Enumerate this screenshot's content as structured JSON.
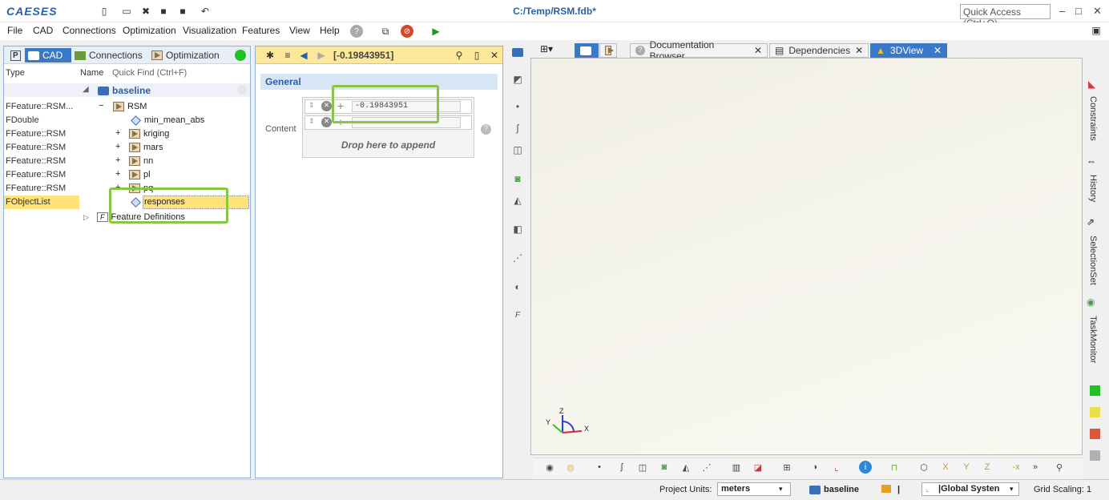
{
  "app": {
    "logo": "CAESES",
    "title": "C:/Temp/RSM.fdb*",
    "quick_access": "Quick Access (Ctrl+Q)"
  },
  "menu": [
    "File",
    "CAD",
    "Connections",
    "Optimization",
    "Visualization",
    "Features",
    "View",
    "Help"
  ],
  "left_panel": {
    "tabs": [
      "P",
      "CAD",
      "Connections",
      "Optimization"
    ],
    "columns": {
      "type": "Type",
      "name": "Name",
      "quick_find": "Quick Find (Ctrl+F)"
    },
    "root": "baseline",
    "rows": [
      {
        "type": "FFeature::RSM...",
        "name": "RSM"
      },
      {
        "type": "FDouble",
        "name": "min_mean_abs"
      },
      {
        "type": "FFeature::RSM",
        "name": "kriging"
      },
      {
        "type": "FFeature::RSM",
        "name": "mars"
      },
      {
        "type": "FFeature::RSM",
        "name": "nn"
      },
      {
        "type": "FFeature::RSM",
        "name": "pl"
      },
      {
        "type": "FFeature::RSM",
        "name": "pq"
      },
      {
        "type": "FObjectList",
        "name": "responses"
      }
    ],
    "feature_definitions": "Feature Definitions",
    "feature_def_icon": "F"
  },
  "mid_panel": {
    "value": "[-0.19843951]",
    "section": "General",
    "content_label": "Content",
    "items": [
      "-0.19843951",
      ""
    ],
    "drop_text": "Drop here to append"
  },
  "view_tabs": [
    "Documentation Browser",
    "Dependencies",
    "3DView"
  ],
  "right_side": [
    "Constraints",
    "History",
    "SelectionSet",
    "TaskMonitor"
  ],
  "axes": {
    "x": "X",
    "y": "Y",
    "z": "Z"
  },
  "status": {
    "project_units_label": "Project Units:",
    "project_units": "meters",
    "baseline": "baseline",
    "coord_system": "|Global Systen",
    "grid_scaling": "Grid Scaling: 1",
    "separator": "|"
  },
  "colors": {
    "accent": "#3a78c8",
    "highlight": "#86c846",
    "selected": "#ffe27a",
    "status_green": "#22c022",
    "status_yellow": "#e8df4a",
    "status_red": "#d9583a",
    "status_gray": "#b0b0b0"
  }
}
